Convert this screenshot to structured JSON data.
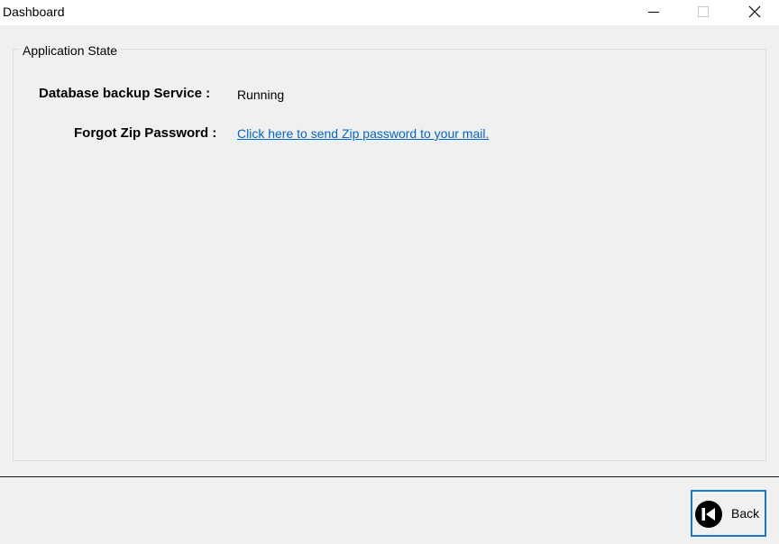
{
  "window": {
    "title": "Dashboard"
  },
  "group": {
    "legend": "Application State"
  },
  "rows": {
    "service_label": "Database backup Service :",
    "service_value": "Running",
    "forgot_label": "Forgot Zip Password :",
    "forgot_link": "Click here to send Zip password to your mail."
  },
  "footer": {
    "back_label": "Back"
  },
  "colors": {
    "link": "#0066cc",
    "focus_border": "#1e78c8"
  },
  "icons": {
    "minimize": "minimize-icon",
    "maximize": "maximize-icon",
    "close": "close-icon",
    "back": "back-skip-icon"
  }
}
